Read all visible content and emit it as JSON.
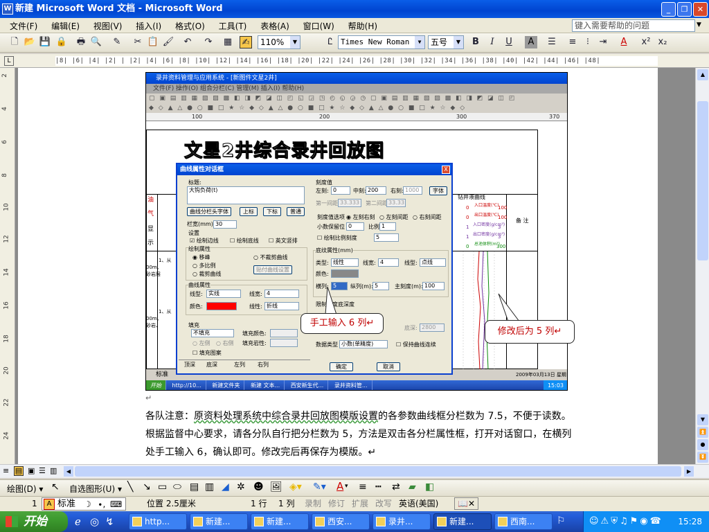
{
  "window": {
    "title": "新建 Microsoft Word 文档 - Microsoft Word",
    "logo": "W"
  },
  "menu": {
    "items": [
      "文件(F)",
      "编辑(E)",
      "视图(V)",
      "插入(I)",
      "格式(O)",
      "工具(T)",
      "表格(A)",
      "窗口(W)",
      "帮助(H)"
    ],
    "help_placeholder": "键入需要帮助的问题"
  },
  "toolbar": {
    "zoom": "110%",
    "font_name": "Times New Roman",
    "font_size": "五号",
    "bold": "B",
    "italic": "I",
    "underline": "U",
    "char_shade": "A",
    "font_color": "A",
    "superscript": "x²",
    "subscript": "x₂"
  },
  "ruler": {
    "marks": "|8| |6| |4| |2| |  |2| |4| |6| |8| |10| |12| |14| |16| |18| |20| |22| |24| |26| |28| |30| |32| |34| |36| |38| |40| |42| |44| |46| |48|",
    "vmarks": [
      "2",
      "4",
      "6",
      "8",
      "10",
      "12",
      "14",
      "16",
      "18",
      "20",
      "22",
      "24"
    ]
  },
  "embedded": {
    "app_title": "录井资料管理与应用系统 - [新图件文星2井]",
    "app_menu": "文件(F)  操作(O)  组合分栏(C)  管理(M)  插入(I)  帮助(H)",
    "ruler_marks": [
      "100",
      "200",
      "300",
      "370"
    ],
    "chart_title": "文星2井综合录井回放图",
    "left_labels": [
      "油",
      "气",
      "显",
      "示"
    ],
    "right_header": "钻井液曲线",
    "right_note": "备 注",
    "curve_labels": [
      "入口温度(℃)",
      "出口温度(℃)",
      "入口密度(g/cm³)",
      "出口密度(g/cm³)",
      "总池体积(m³)"
    ],
    "scale_vals": [
      "0",
      "100",
      "0",
      "100",
      "1",
      "3",
      "1",
      "3",
      "0",
      "300"
    ],
    "left_notes": [
      "1、从",
      "00m、",
      "砂岩层",
      "1、从",
      "00m、",
      "砂岩、"
    ],
    "status_text": "标准",
    "status_date": "2009年03月13日 星期五",
    "taskbar": [
      "开始",
      "http://10...",
      "新建文件夹",
      "新建 文本...",
      "西安新生代...",
      "录井资料管...",
      "15:03"
    ]
  },
  "dialog": {
    "title": "曲线属性对话框",
    "close": "X",
    "title_label": "标题:",
    "title_value": "大钩负荷(t)",
    "btn_curve_font": "曲线分栏头字体",
    "btn_up": "上标",
    "btn_down": "下标",
    "btn_normal": "普通",
    "col_width_label": "栏宽(mm):",
    "col_width_value": "30",
    "settings_label": "设置",
    "cb_draw_border": "绘制边线",
    "cb_draw_bottom": "绘制底线",
    "cb_english_vertical": "英文竖排",
    "draw_attr_label": "绘制属性",
    "rb_translate": "移峰",
    "rb_no_curve": "不裁剪曲线",
    "rb_multi_scale": "多比例",
    "rb_clip_curve": "裁剪曲线",
    "btn_draw_settings": "贴付曲线设置",
    "curve_attr_label": "曲线属性",
    "line_type_label": "线型:",
    "line_type_value": "实线",
    "line_width_label": "线宽:",
    "line_width_value": "4",
    "color_label": "颜色:",
    "color_value": "#ff0000",
    "line_shape_label": "线性:",
    "line_shape_value": "折线",
    "fill_label": "填充",
    "fill_value": "不填充",
    "fill_color_label": "填充颜色:",
    "rb_left": "左侧",
    "rb_right": "右侧",
    "fill_rock_label": "填充岩性:",
    "cb_fill_pattern": "填充图案",
    "tabs": [
      "顶深",
      "底深",
      "左列",
      "右列"
    ],
    "scale_label": "刻度值",
    "left_scale_label": "左刻:",
    "left_scale_value": "0",
    "mid_scale_label": "中刻:",
    "mid_scale_value": "200",
    "right_scale_label": "右刻:",
    "right_scale_value": "1000",
    "btn_font": "字体",
    "first_interval_label": "第一间距:",
    "first_interval_value": "33.333",
    "second_interval_label": "第二间距:",
    "second_interval_value": "33.33",
    "scale_opt_label": "刻度值选项",
    "rb_left_right": "左刻右刻",
    "rb_left_gap": "左刻间距",
    "rb_right_gap": "右刻间距",
    "decimal_label": "小数保留位",
    "decimal_value": "0",
    "ratio_label": "比例",
    "ratio_value": "1",
    "cb_draw_ratio": "绘制比例刻度",
    "ratio_scale_value": "5",
    "grid_attr_label": "底纹属性(mm)",
    "grid_type_label": "类型:",
    "grid_type_value": "线性",
    "grid_width_label": "线宽:",
    "grid_width_value": "4",
    "grid_linetype_label": "线型:",
    "grid_linetype_value": "点线",
    "grid_color_label": "颜色:",
    "hcols_label": "横列:",
    "hcols_value": "5",
    "vcols_label": "纵列(m):",
    "vcols_value": "5",
    "main_scale_label": "主刻度(m):",
    "main_scale_value": "100",
    "depth_limit_label": "限制深度底深度",
    "bottom_depth_label": "底深:",
    "bottom_depth_value": "2800",
    "data_type_label": "数据类型",
    "data_type_value": "小数(单精度)",
    "cb_keep_curve": "保持曲线连续",
    "btn_ok": "确定",
    "btn_cancel": "取消"
  },
  "callouts": {
    "manual": "手工输入 6 列↵",
    "modified": "修改后为 5 列↵"
  },
  "paragraph": {
    "blank": "↵",
    "text_before": "各队注意：",
    "underlined_1": "原资料处理系统中综合录井回放图模版设置",
    "text_mid": "的各参数曲线框分栏数为 7.5，不便于读数。根据监督中心要求，请各分队自行把分栏数为 5，方法是双击各分栏属性框，打开对话窗口，在横列处手工输入 6，确认即可。修改完后再保存为模版。↵"
  },
  "drawbar": {
    "draw": "绘图(D)",
    "autoshape": "自选图形(U)"
  },
  "statusbar": {
    "page": "1",
    "style": "标准",
    "position": "位置 2.5厘米",
    "line": "1 行",
    "col": "1 列",
    "rec": "录制",
    "trk": "修订",
    "ext": "扩展",
    "ovr": "改写",
    "lang": "英语(美国)"
  },
  "taskbar": {
    "start": "开始",
    "items": [
      "http...",
      "新建...",
      "新建...",
      "西安...",
      "录井...",
      "新建...",
      "西南..."
    ],
    "clock": "15:28"
  }
}
